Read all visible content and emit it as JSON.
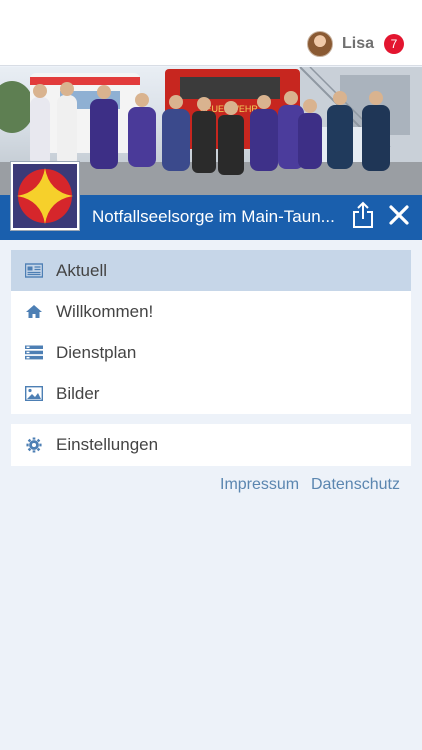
{
  "header": {
    "user_name": "Lisa",
    "notification_count": "7",
    "avatar_icon": "user-avatar"
  },
  "banner": {
    "title": "Notfallseelsorge im Main-Taun...",
    "share_icon": "share-icon",
    "close_icon": "close-icon",
    "color": "#1a5fad"
  },
  "menu": {
    "items": [
      {
        "label": "Aktuell",
        "icon": "newspaper-icon",
        "active": true
      },
      {
        "label": "Willkommen!",
        "icon": "home-icon",
        "active": false
      },
      {
        "label": "Dienstplan",
        "icon": "list-icon",
        "active": false
      },
      {
        "label": "Bilder",
        "icon": "image-icon",
        "active": false
      }
    ],
    "settings": {
      "label": "Einstellungen",
      "icon": "gear-icon"
    }
  },
  "footer": {
    "impressum": "Impressum",
    "datenschutz": "Datenschutz"
  },
  "colors": {
    "accent": "#1a5fad",
    "active_item": "#c6d6e8",
    "badge": "#e3152f",
    "link": "#5b86b0",
    "background": "#edf2f9"
  }
}
